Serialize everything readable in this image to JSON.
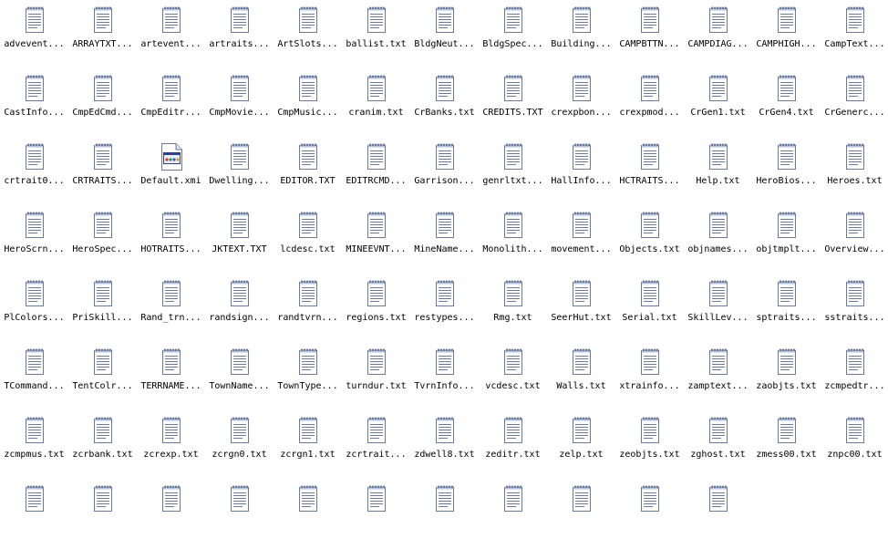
{
  "files": [
    {
      "name": "advevent...",
      "icon": "notepad-icon"
    },
    {
      "name": "ARRAYTXT...",
      "icon": "notepad-icon"
    },
    {
      "name": "artevent...",
      "icon": "notepad-icon"
    },
    {
      "name": "artraits...",
      "icon": "notepad-icon"
    },
    {
      "name": "ArtSlots...",
      "icon": "notepad-icon"
    },
    {
      "name": "ballist.txt",
      "icon": "notepad-icon"
    },
    {
      "name": "BldgNeut...",
      "icon": "notepad-icon"
    },
    {
      "name": "BldgSpec...",
      "icon": "notepad-icon"
    },
    {
      "name": "Building...",
      "icon": "notepad-icon"
    },
    {
      "name": "CAMPBTTN...",
      "icon": "notepad-icon"
    },
    {
      "name": "CAMPDIAG...",
      "icon": "notepad-icon"
    },
    {
      "name": "CAMPHIGH...",
      "icon": "notepad-icon"
    },
    {
      "name": "CampText...",
      "icon": "notepad-icon"
    },
    {
      "name": "CastInfo...",
      "icon": "notepad-icon"
    },
    {
      "name": "CmpEdCmd...",
      "icon": "notepad-icon"
    },
    {
      "name": "CmpEditr...",
      "icon": "notepad-icon"
    },
    {
      "name": "CmpMovie...",
      "icon": "notepad-icon"
    },
    {
      "name": "CmpMusic...",
      "icon": "notepad-icon"
    },
    {
      "name": "cranim.txt",
      "icon": "notepad-icon"
    },
    {
      "name": "CrBanks.txt",
      "icon": "notepad-icon"
    },
    {
      "name": "CREDITS.TXT",
      "icon": "notepad-icon"
    },
    {
      "name": "crexpbon...",
      "icon": "notepad-icon"
    },
    {
      "name": "crexpmod...",
      "icon": "notepad-icon"
    },
    {
      "name": "CrGen1.txt",
      "icon": "notepad-icon"
    },
    {
      "name": "CrGen4.txt",
      "icon": "notepad-icon"
    },
    {
      "name": "CrGenerc...",
      "icon": "notepad-icon"
    },
    {
      "name": "crtrait0...",
      "icon": "notepad-icon"
    },
    {
      "name": "CRTRAITS...",
      "icon": "notepad-icon"
    },
    {
      "name": "Default.xmi",
      "icon": "xmi-file-icon"
    },
    {
      "name": "Dwelling...",
      "icon": "notepad-icon"
    },
    {
      "name": "EDITOR.TXT",
      "icon": "notepad-icon"
    },
    {
      "name": "EDITRCMD...",
      "icon": "notepad-icon"
    },
    {
      "name": "Garrison...",
      "icon": "notepad-icon"
    },
    {
      "name": "genrltxt...",
      "icon": "notepad-icon"
    },
    {
      "name": "HallInfo...",
      "icon": "notepad-icon"
    },
    {
      "name": "HCTRAITS...",
      "icon": "notepad-icon"
    },
    {
      "name": "Help.txt",
      "icon": "notepad-icon"
    },
    {
      "name": "HeroBios...",
      "icon": "notepad-icon"
    },
    {
      "name": "Heroes.txt",
      "icon": "notepad-icon"
    },
    {
      "name": "HeroScrn...",
      "icon": "notepad-icon"
    },
    {
      "name": "HeroSpec...",
      "icon": "notepad-icon"
    },
    {
      "name": "HOTRAITS...",
      "icon": "notepad-icon"
    },
    {
      "name": "JKTEXT.TXT",
      "icon": "notepad-icon"
    },
    {
      "name": "lcdesc.txt",
      "icon": "notepad-icon"
    },
    {
      "name": "MINEEVNT...",
      "icon": "notepad-icon"
    },
    {
      "name": "MineName...",
      "icon": "notepad-icon"
    },
    {
      "name": "Monolith...",
      "icon": "notepad-icon"
    },
    {
      "name": "movement...",
      "icon": "notepad-icon"
    },
    {
      "name": "Objects.txt",
      "icon": "notepad-icon"
    },
    {
      "name": "objnames...",
      "icon": "notepad-icon"
    },
    {
      "name": "objtmplt...",
      "icon": "notepad-icon"
    },
    {
      "name": "Overview...",
      "icon": "notepad-icon"
    },
    {
      "name": "PlColors...",
      "icon": "notepad-icon"
    },
    {
      "name": "PriSkill...",
      "icon": "notepad-icon"
    },
    {
      "name": "Rand_trn...",
      "icon": "notepad-icon"
    },
    {
      "name": "randsign...",
      "icon": "notepad-icon"
    },
    {
      "name": "randtvrn...",
      "icon": "notepad-icon"
    },
    {
      "name": "regions.txt",
      "icon": "notepad-icon"
    },
    {
      "name": "restypes...",
      "icon": "notepad-icon"
    },
    {
      "name": "Rmg.txt",
      "icon": "notepad-icon"
    },
    {
      "name": "SeerHut.txt",
      "icon": "notepad-icon"
    },
    {
      "name": "Serial.txt",
      "icon": "notepad-icon"
    },
    {
      "name": "SkillLev...",
      "icon": "notepad-icon"
    },
    {
      "name": "sptraits...",
      "icon": "notepad-icon"
    },
    {
      "name": "sstraits...",
      "icon": "notepad-icon"
    },
    {
      "name": "TCommand...",
      "icon": "notepad-icon"
    },
    {
      "name": "TentColr...",
      "icon": "notepad-icon"
    },
    {
      "name": "TERRNAME...",
      "icon": "notepad-icon"
    },
    {
      "name": "TownName...",
      "icon": "notepad-icon"
    },
    {
      "name": "TownType...",
      "icon": "notepad-icon"
    },
    {
      "name": "turndur.txt",
      "icon": "notepad-icon"
    },
    {
      "name": "TvrnInfo...",
      "icon": "notepad-icon"
    },
    {
      "name": "vcdesc.txt",
      "icon": "notepad-icon"
    },
    {
      "name": "Walls.txt",
      "icon": "notepad-icon"
    },
    {
      "name": "xtrainfo...",
      "icon": "notepad-icon"
    },
    {
      "name": "zamptext...",
      "icon": "notepad-icon"
    },
    {
      "name": "zaobjts.txt",
      "icon": "notepad-icon"
    },
    {
      "name": "zcmpedtr...",
      "icon": "notepad-icon"
    },
    {
      "name": "zcmpmus.txt",
      "icon": "notepad-icon"
    },
    {
      "name": "zcrbank.txt",
      "icon": "notepad-icon"
    },
    {
      "name": "zcrexp.txt",
      "icon": "notepad-icon"
    },
    {
      "name": "zcrgn0.txt",
      "icon": "notepad-icon"
    },
    {
      "name": "zcrgn1.txt",
      "icon": "notepad-icon"
    },
    {
      "name": "zcrtrait...",
      "icon": "notepad-icon"
    },
    {
      "name": "zdwell8.txt",
      "icon": "notepad-icon"
    },
    {
      "name": "zeditr.txt",
      "icon": "notepad-icon"
    },
    {
      "name": "zelp.txt",
      "icon": "notepad-icon"
    },
    {
      "name": "zeobjts.txt",
      "icon": "notepad-icon"
    },
    {
      "name": "zghost.txt",
      "icon": "notepad-icon"
    },
    {
      "name": "zmess00.txt",
      "icon": "notepad-icon"
    },
    {
      "name": "znpc00.txt",
      "icon": "notepad-icon"
    },
    {
      "name": "",
      "icon": "notepad-icon"
    },
    {
      "name": "",
      "icon": "notepad-icon"
    },
    {
      "name": "",
      "icon": "notepad-icon"
    },
    {
      "name": "",
      "icon": "notepad-icon"
    },
    {
      "name": "",
      "icon": "notepad-icon"
    },
    {
      "name": "",
      "icon": "notepad-icon"
    },
    {
      "name": "",
      "icon": "notepad-icon"
    },
    {
      "name": "",
      "icon": "notepad-icon"
    },
    {
      "name": "",
      "icon": "notepad-icon"
    },
    {
      "name": "",
      "icon": "notepad-icon"
    },
    {
      "name": "",
      "icon": "notepad-icon"
    }
  ]
}
